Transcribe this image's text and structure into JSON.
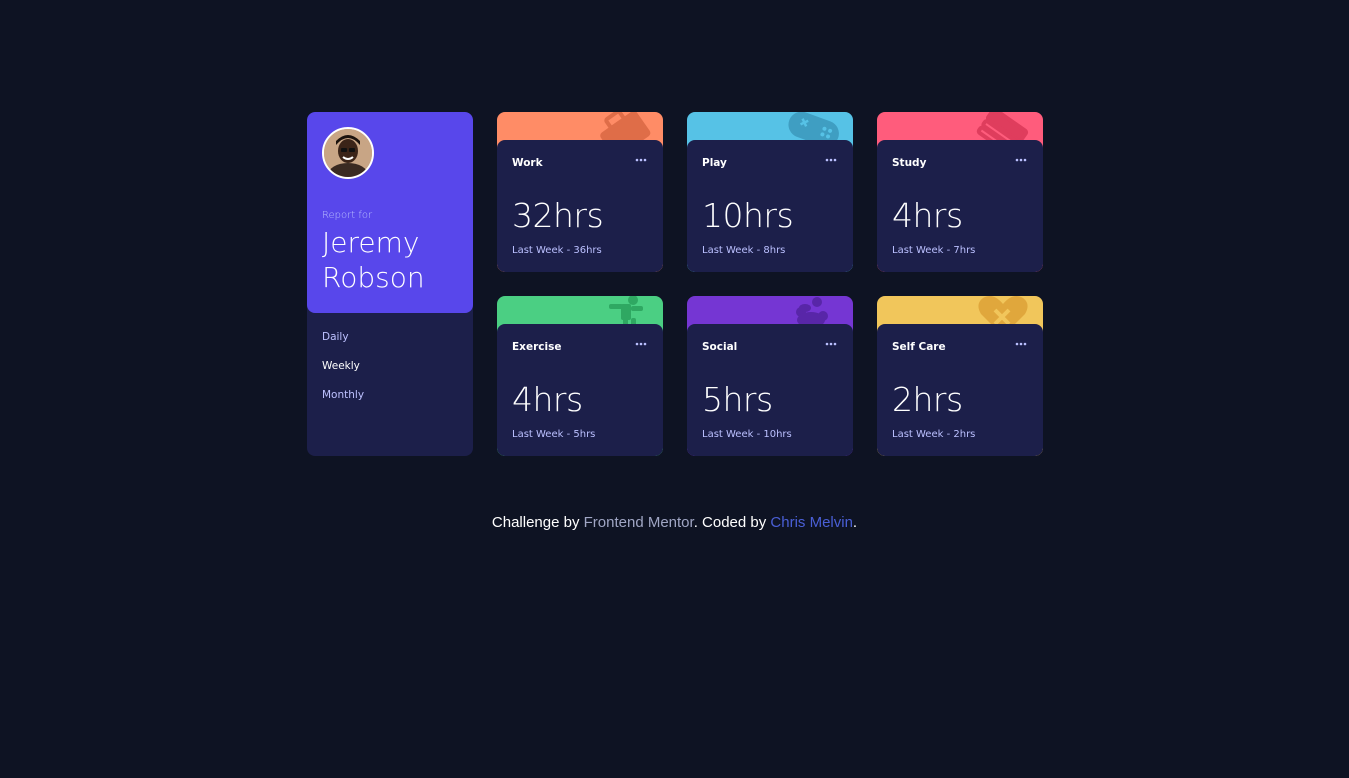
{
  "profile": {
    "report_for": "Report for",
    "name": "Jeremy Robson",
    "periods": [
      "Daily",
      "Weekly",
      "Monthly"
    ],
    "active_period": "Weekly",
    "accent_color": "#5847eb"
  },
  "cards": [
    {
      "title": "Work",
      "hours": "32hrs",
      "previous": "Last Week - 36hrs",
      "color": "#ff8c66",
      "icon": "briefcase-icon"
    },
    {
      "title": "Play",
      "hours": "10hrs",
      "previous": "Last Week - 8hrs",
      "color": "#56c2e6",
      "icon": "gamepad-icon"
    },
    {
      "title": "Study",
      "hours": "4hrs",
      "previous": "Last Week - 7hrs",
      "color": "#ff5c7c",
      "icon": "books-icon"
    },
    {
      "title": "Exercise",
      "hours": "4hrs",
      "previous": "Last Week - 5hrs",
      "color": "#4bcf83",
      "icon": "running-icon"
    },
    {
      "title": "Social",
      "hours": "5hrs",
      "previous": "Last Week - 10hrs",
      "color": "#7536d3",
      "icon": "social-icon"
    },
    {
      "title": "Self Care",
      "hours": "2hrs",
      "previous": "Last Week - 2hrs",
      "color": "#f1c65b",
      "icon": "self-care-icon"
    }
  ],
  "footer": {
    "prefix": "Challenge by ",
    "link1": "Frontend Mentor",
    "middle": ". Coded by ",
    "link2": "Chris Melvin",
    "suffix": "."
  }
}
